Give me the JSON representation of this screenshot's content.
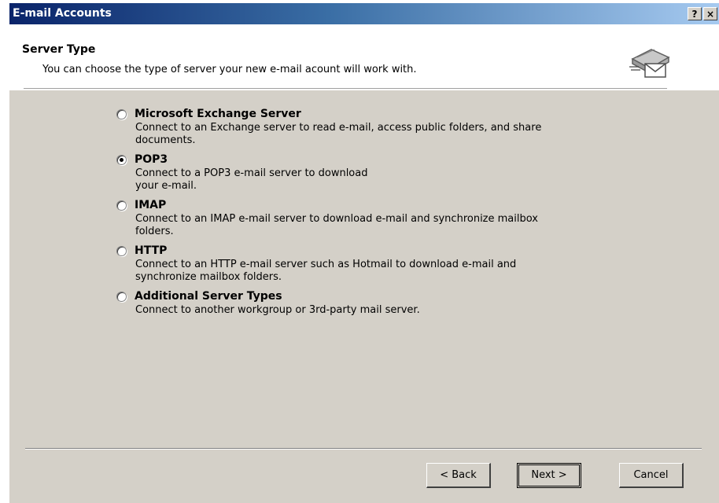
{
  "window": {
    "title": "E-mail Accounts",
    "help_label": "?",
    "close_label": "×"
  },
  "header": {
    "title": "Server Type",
    "subtitle": "You can choose the type of server your new e-mail acount will work with.",
    "icon": "mail-server-icon"
  },
  "options": [
    {
      "label": "Microsoft Exchange Server",
      "description": "Connect to an Exchange server to read e-mail, access public folders, and share documents.",
      "checked": false
    },
    {
      "label": "POP3",
      "description_line1": "Connect to a POP3 e-mail server to download",
      "description_line2": "your e-mail.",
      "checked": true
    },
    {
      "label": "IMAP",
      "description": "Connect to an IMAP e-mail server to download e-mail and synchronize mailbox folders.",
      "checked": false
    },
    {
      "label": "HTTP",
      "description": "Connect to an HTTP e-mail server such as Hotmail to download e-mail and synchronize mailbox folders.",
      "checked": false
    },
    {
      "label": "Additional Server Types",
      "description": "Connect to another workgroup or 3rd-party mail server.",
      "checked": false
    }
  ],
  "buttons": {
    "back": "< Back",
    "next": "Next >",
    "cancel": "Cancel"
  },
  "colors": {
    "titlebar_start": "#0a246a",
    "titlebar_end": "#a6caf0",
    "dialog_face": "#d4d0c8"
  }
}
